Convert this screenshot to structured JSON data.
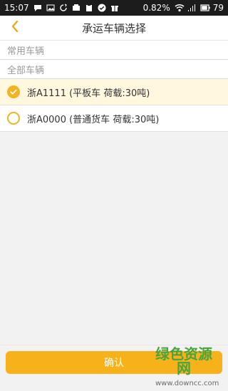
{
  "status": {
    "time": "15:07",
    "battery_pct": "0.82%",
    "battery_level": "79"
  },
  "header": {
    "title": "承运车辆选择"
  },
  "sections": {
    "common": "常用车辆",
    "all": "全部车辆"
  },
  "vehicles": [
    {
      "label": "浙A1111 (平板车 荷载:30吨)",
      "selected": true
    },
    {
      "label": "浙A0000 (普通货车 荷载:30吨)",
      "selected": false
    }
  ],
  "actions": {
    "confirm": "确认"
  },
  "watermark": {
    "title": "绿色资源网",
    "url": "www.downcc.com"
  },
  "colors": {
    "accent": "#f2b321",
    "status_bar": "#1c1c1c"
  }
}
